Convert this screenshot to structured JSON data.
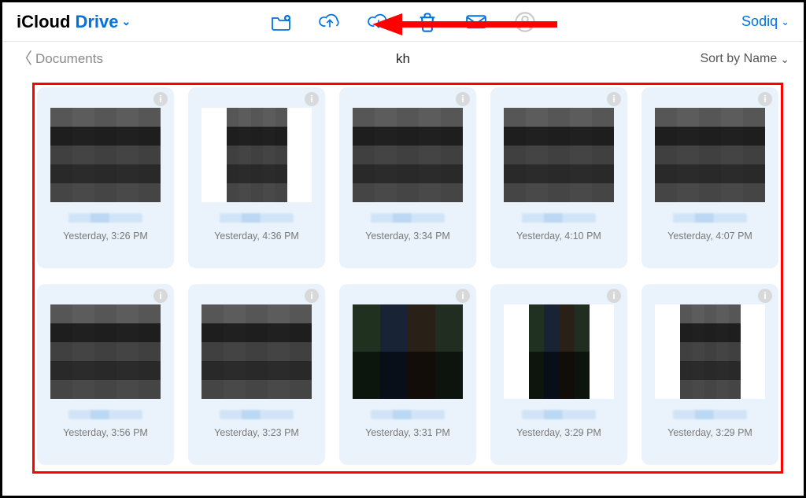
{
  "brand": {
    "icloud": "iCloud",
    "drive": "Drive"
  },
  "user": {
    "name": "Sodiq"
  },
  "back": {
    "label": "Documents"
  },
  "folder": {
    "title": "kh"
  },
  "sort": {
    "label": "Sort by Name"
  },
  "tiles": [
    {
      "ts": "Yesterday, 3:26 PM",
      "shape": "wide",
      "style": "dark"
    },
    {
      "ts": "Yesterday, 4:36 PM",
      "shape": "narrow",
      "style": "dark"
    },
    {
      "ts": "Yesterday, 3:34 PM",
      "shape": "wide",
      "style": "dark"
    },
    {
      "ts": "Yesterday, 4:10 PM",
      "shape": "wide",
      "style": "dark"
    },
    {
      "ts": "Yesterday, 4:07 PM",
      "shape": "wide",
      "style": "dark"
    },
    {
      "ts": "Yesterday, 3:56 PM",
      "shape": "wide",
      "style": "dark"
    },
    {
      "ts": "Yesterday, 3:23 PM",
      "shape": "wide",
      "style": "dark"
    },
    {
      "ts": "Yesterday, 3:31 PM",
      "shape": "wide",
      "style": "color"
    },
    {
      "ts": "Yesterday, 3:29 PM",
      "shape": "narrow",
      "style": "color"
    },
    {
      "ts": "Yesterday, 3:29 PM",
      "shape": "narrow",
      "style": "dark"
    }
  ],
  "icons": {
    "new_folder": "new-folder-icon",
    "upload": "cloud-upload-icon",
    "download": "cloud-download-icon",
    "delete": "trash-icon",
    "share": "mail-icon",
    "profile": "profile-icon"
  }
}
